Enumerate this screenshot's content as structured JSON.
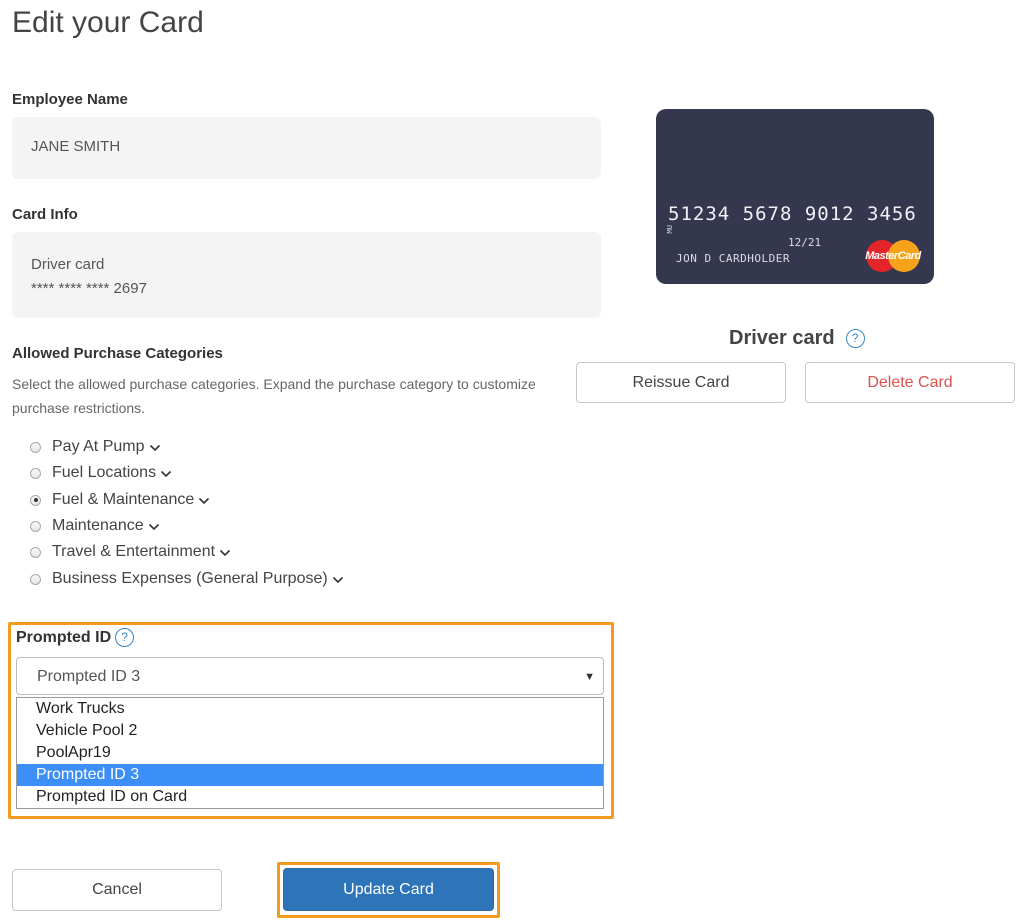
{
  "page": {
    "title": "Edit your Card"
  },
  "employee": {
    "label": "Employee Name",
    "value": "JANE SMITH"
  },
  "card_info": {
    "label": "Card Info",
    "type": "Driver card",
    "masked_number": "**** **** **** 2697"
  },
  "categories": {
    "label": "Allowed Purchase Categories",
    "description": "Select the allowed purchase categories. Expand the purchase category to customize purchase restrictions.",
    "options": [
      {
        "label": "Pay At Pump",
        "checked": false
      },
      {
        "label": "Fuel Locations",
        "checked": false
      },
      {
        "label": "Fuel & Maintenance",
        "checked": true
      },
      {
        "label": "Maintenance",
        "checked": false
      },
      {
        "label": "Travel & Entertainment",
        "checked": false
      },
      {
        "label": "Business Expenses (General Purpose)",
        "checked": false
      }
    ]
  },
  "prompted_id": {
    "label": "Prompted ID",
    "help_icon": "?",
    "selected": "Prompted ID 3",
    "options": [
      "Work Trucks",
      "Vehicle Pool 2",
      "PoolApr19",
      "Prompted ID 3",
      "Prompted ID on Card"
    ],
    "selected_index": 3
  },
  "card_preview": {
    "number": "51234 5678 9012 3456",
    "side_text": "MU",
    "expiry": "12/21",
    "holder": "JON D CARDHOLDER",
    "brand": "MasterCard",
    "caption": "Driver card",
    "help_icon": "?"
  },
  "actions": {
    "reissue": "Reissue Card",
    "delete": "Delete Card",
    "cancel": "Cancel",
    "update": "Update Card"
  },
  "colors": {
    "accent_blue": "#2d75b8",
    "highlight_orange": "#f29a1d",
    "selected_option": "#3c8ff7",
    "delete_red": "#d9534f",
    "card_bg": "#35374f"
  }
}
